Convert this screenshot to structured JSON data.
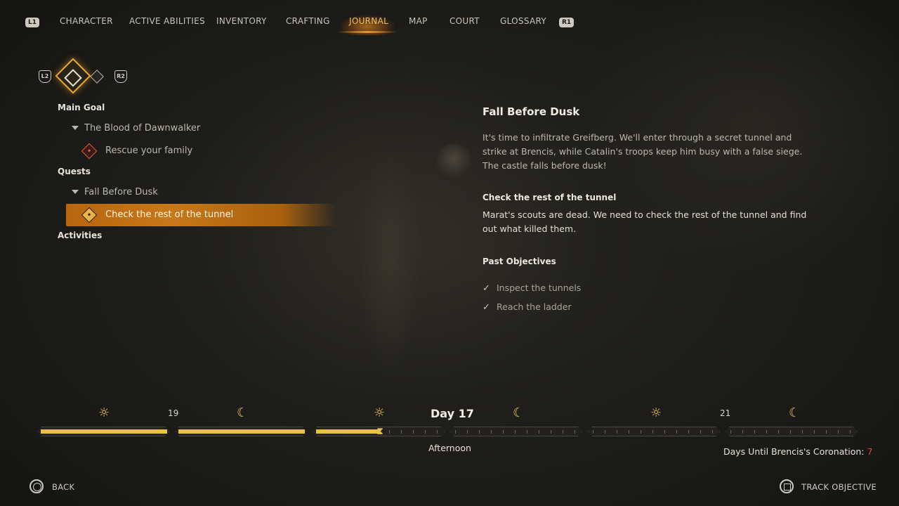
{
  "nav": {
    "left_shoulder": "L1",
    "right_shoulder": "R1",
    "tabs": [
      {
        "label": "CHARACTER"
      },
      {
        "label": "ACTIVE ABILITIES"
      },
      {
        "label": "INVENTORY"
      },
      {
        "label": "CRAFTING"
      },
      {
        "label": "JOURNAL",
        "active": true
      },
      {
        "label": "MAP"
      },
      {
        "label": "COURT"
      },
      {
        "label": "GLOSSARY"
      }
    ]
  },
  "subnav": {
    "left_trigger": "L2",
    "right_trigger": "R2",
    "icons": [
      "quest-diamond-icon",
      "small-diamond-icon"
    ]
  },
  "quests": {
    "main_goal": {
      "heading": "Main Goal",
      "group": "The Blood of Dawnwalker",
      "objective": "Rescue your family"
    },
    "quests_section": {
      "heading": "Quests",
      "group": "Fall Before Dusk",
      "objective": "Check the rest of the tunnel"
    },
    "activities": {
      "heading": "Activities"
    }
  },
  "detail": {
    "title": "Fall Before Dusk",
    "description": "It's time to infiltrate Greifberg. We'll enter through a secret tunnel and strike at Brencis, while Catalin's troops keep him busy with a false siege. The castle falls before dusk!",
    "objective_title": "Check the rest of the tunnel",
    "objective_text": "Marat's scouts are dead. We need to check the rest of the tunnel and find out what killed them.",
    "past_heading": "Past Objectives",
    "past_objectives": [
      "Inspect the tunnels",
      "Reach the ladder"
    ]
  },
  "timeline": {
    "day_label": "Day 17",
    "prev_day": "19",
    "next_day": "21",
    "time_of_day": "Afternoon",
    "coronation_label": "Days Until Brencis's Coronation:",
    "coronation_days": "7",
    "segment_fill": [
      1.0,
      1.0,
      0.5,
      0.0,
      0.0,
      0.0
    ],
    "accent": "#e7c23a"
  },
  "footer": {
    "back_label": "BACK",
    "track_label": "TRACK OBJECTIVE"
  }
}
